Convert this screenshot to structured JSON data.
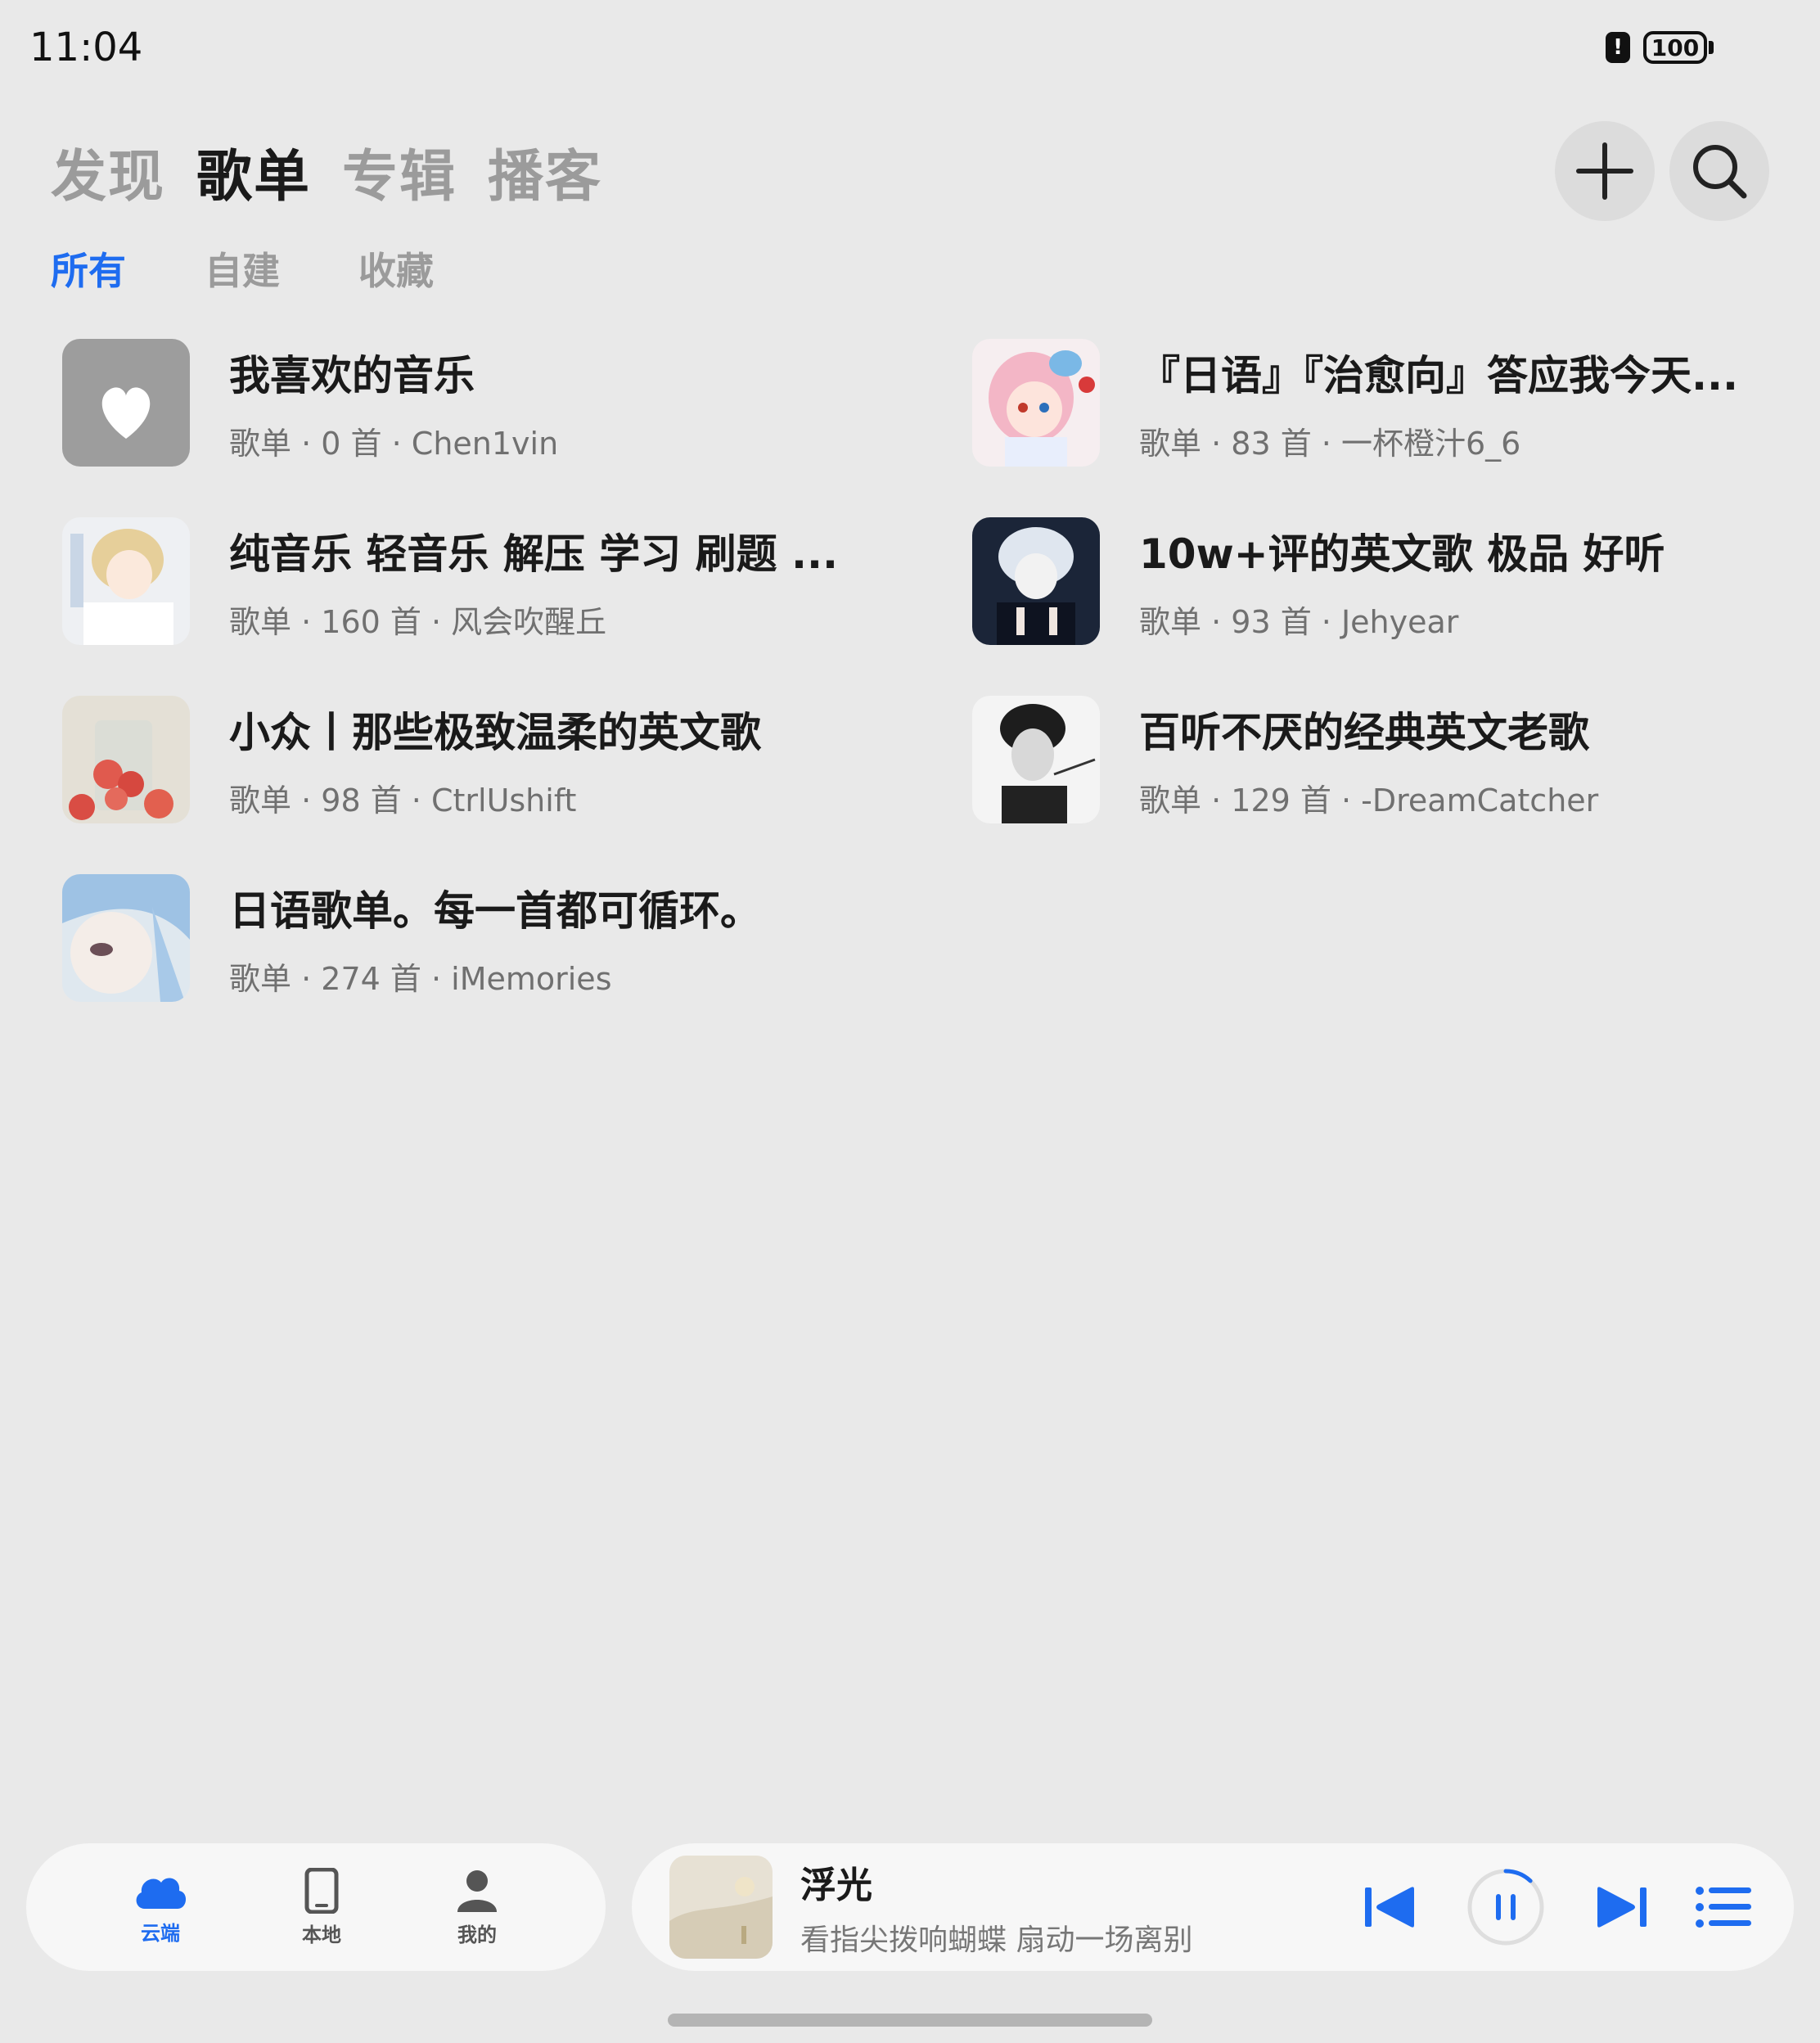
{
  "status": {
    "time": "11:04",
    "battery": "100",
    "alert": "!"
  },
  "top_tabs": [
    {
      "label": "发现",
      "active": false
    },
    {
      "label": "歌单",
      "active": true
    },
    {
      "label": "专辑",
      "active": false
    },
    {
      "label": "播客",
      "active": false
    }
  ],
  "sub_tabs": [
    {
      "label": "所有",
      "active": true
    },
    {
      "label": "自建",
      "active": false
    },
    {
      "label": "收藏",
      "active": false
    }
  ],
  "playlists": [
    {
      "title": "我喜欢的音乐",
      "type": "歌单",
      "count": "0 首",
      "owner": "Chen1vin",
      "cover": "heart-cover"
    },
    {
      "title": "『日语』『治愈向』答应我今天...",
      "type": "歌单",
      "count": "83 首",
      "owner": "一杯橙汁6_6",
      "cover": "anime-pink-cover"
    },
    {
      "title": "纯音乐 轻音乐 解压 学习 刷题 ...",
      "type": "歌单",
      "count": "160 首",
      "owner": "风会吹醒丘",
      "cover": "anime-boy-cover"
    },
    {
      "title": "10w+评的英文歌 极品 好听",
      "type": "歌单",
      "count": "93 首",
      "owner": "Jehyear",
      "cover": "anime-dark-cover"
    },
    {
      "title": "小众丨那些极致温柔的英文歌",
      "type": "歌单",
      "count": "98 首",
      "owner": "CtrlUshift",
      "cover": "peaches-cover"
    },
    {
      "title": "百听不厌的经典英文老歌",
      "type": "歌单",
      "count": "129 首",
      "owner": "-DreamCatcher",
      "cover": "portrait-bw-cover"
    },
    {
      "title": "日语歌单。每一首都可循环。",
      "type": "歌单",
      "count": "274 首",
      "owner": "iMemories",
      "cover": "anime-blue-hair-cover"
    }
  ],
  "bottom_nav": [
    {
      "label": "云端",
      "icon": "cloud-icon",
      "active": true
    },
    {
      "label": "本地",
      "icon": "tablet-icon",
      "active": false
    },
    {
      "label": "我的",
      "icon": "person-icon",
      "active": false
    }
  ],
  "player": {
    "title": "浮光",
    "lyric": "看指尖拨响蝴蝶  扇动一场离别",
    "progress": 0.12
  },
  "colors": {
    "accent": "#1e6cf0",
    "background": "#e9e9e9",
    "inactive_tab": "#9b9b9b"
  }
}
